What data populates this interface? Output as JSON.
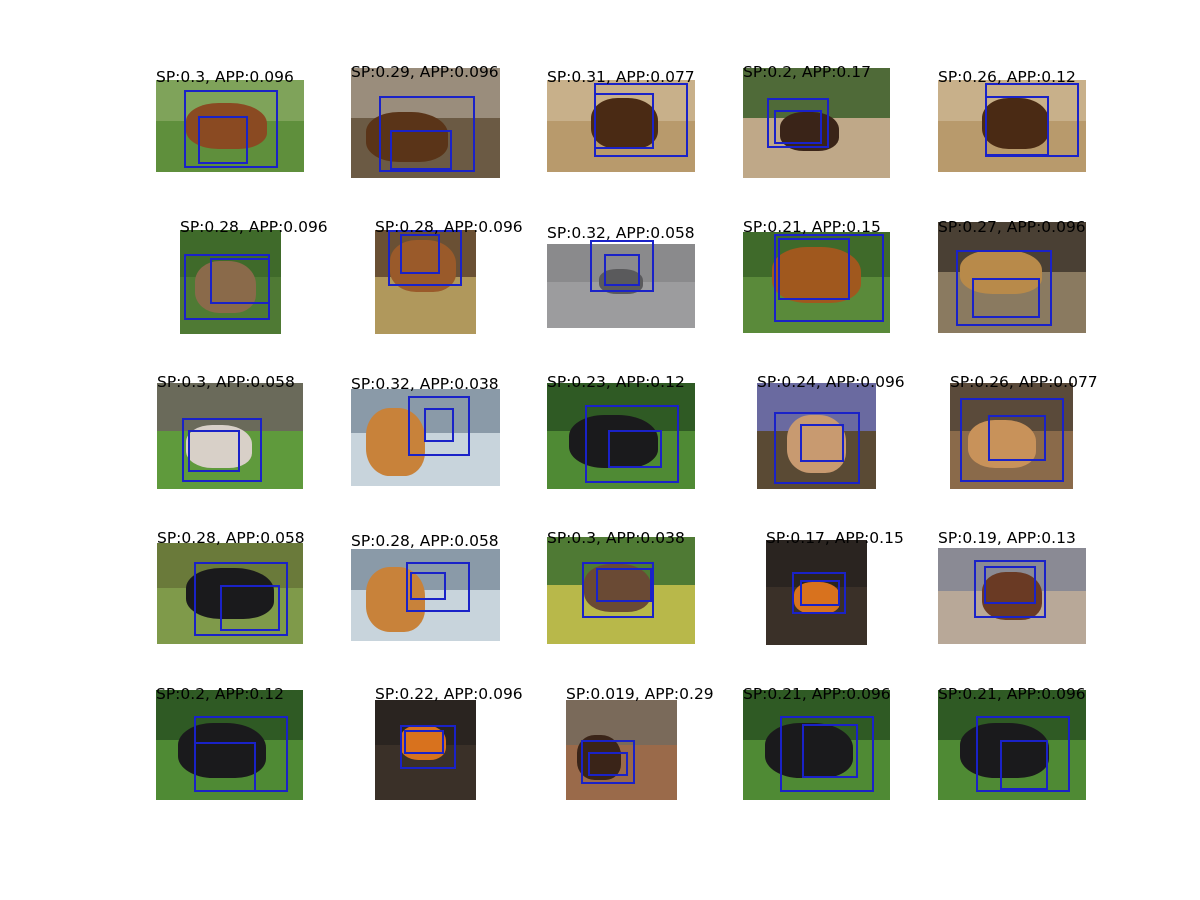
{
  "figure": {
    "panels": [
      {
        "caption": "SP:0.3,  APP:0.096",
        "colors": [
          "#7fa35a",
          "#5f8f3c"
        ],
        "horse": "#8a4a22"
      },
      {
        "caption": "SP:0.29,  APP:0.096",
        "colors": [
          "#9a8d7c",
          "#6b5a44"
        ],
        "horse": "#5a3418"
      },
      {
        "caption": "SP:0.31,  APP:0.077",
        "colors": [
          "#c8b08a",
          "#b89a6c"
        ],
        "horse": "#4a2a14"
      },
      {
        "caption": "SP:0.2,  APP:0.17",
        "colors": [
          "#4f6a38",
          "#bfa888"
        ],
        "horse": "#3a2418"
      },
      {
        "caption": "SP:0.26,  APP:0.12",
        "colors": [
          "#c8b08a",
          "#b89a6c"
        ],
        "horse": "#4a2a14"
      },
      {
        "caption": "SP:0.28,  APP:0.096",
        "colors": [
          "#3f6a2a",
          "#4f7a34"
        ],
        "horse": "#8a6a4a"
      },
      {
        "caption": "SP:0.28,  APP:0.096",
        "colors": [
          "#6a5034",
          "#b0985c"
        ],
        "horse": "#9a5a2a"
      },
      {
        "caption": "SP:0.32,  APP:0.058",
        "colors": [
          "#8a8a8c",
          "#9c9c9e"
        ],
        "horse": "#5a5a5c"
      },
      {
        "caption": "SP:0.21,  APP:0.15",
        "colors": [
          "#3f6a2a",
          "#5a8a3a"
        ],
        "horse": "#a0581e"
      },
      {
        "caption": "SP:0.27,  APP:0.096",
        "colors": [
          "#4a4034",
          "#8a7a60"
        ],
        "horse": "#b88a4a"
      },
      {
        "caption": "SP:0.3,  APP:0.058",
        "colors": [
          "#6a6a5a",
          "#5f9a3c"
        ],
        "horse": "#d8d0c8"
      },
      {
        "caption": "SP:0.32,  APP:0.038",
        "colors": [
          "#8a9aa8",
          "#c8d4dc"
        ],
        "horse": "#c8823a"
      },
      {
        "caption": "SP:0.23,  APP:0.12",
        "colors": [
          "#2f5a24",
          "#4f8a34"
        ],
        "horse": "#1a1a1c"
      },
      {
        "caption": "SP:0.24,  APP:0.096",
        "colors": [
          "#6a6aa0",
          "#5a4a34"
        ],
        "horse": "#c89a70"
      },
      {
        "caption": "SP:0.26,  APP:0.077",
        "colors": [
          "#5a4a3a",
          "#8a6a4a"
        ],
        "horse": "#c8925a"
      },
      {
        "caption": "SP:0.28,  APP:0.058",
        "colors": [
          "#6a7a3a",
          "#7f9a4a"
        ],
        "horse": "#1a1a1c"
      },
      {
        "caption": "SP:0.28,  APP:0.058",
        "colors": [
          "#8a9aa8",
          "#c8d4dc"
        ],
        "horse": "#c8823a"
      },
      {
        "caption": "SP:0.3,  APP:0.038",
        "colors": [
          "#4f7a34",
          "#b8b84a"
        ],
        "horse": "#6a4a34"
      },
      {
        "caption": "SP:0.17,  APP:0.15",
        "colors": [
          "#2a2420",
          "#3a3028"
        ],
        "horse": "#d8721e"
      },
      {
        "caption": "SP:0.19,  APP:0.13",
        "colors": [
          "#8a8a94",
          "#b8a898"
        ],
        "horse": "#6a3a24"
      },
      {
        "caption": "SP:0.2,  APP:0.12",
        "colors": [
          "#2f5a24",
          "#4f8a34"
        ],
        "horse": "#1a1a1c"
      },
      {
        "caption": "SP:0.22,  APP:0.096",
        "colors": [
          "#2a2420",
          "#3a3028"
        ],
        "horse": "#d8721e"
      },
      {
        "caption": "SP:0.019,  APP:0.29",
        "colors": [
          "#7a6a5a",
          "#9a6a4a"
        ],
        "horse": "#3a2418"
      },
      {
        "caption": "SP:0.21,  APP:0.096",
        "colors": [
          "#2f5a24",
          "#4f8a34"
        ],
        "horse": "#1a1a1c"
      },
      {
        "caption": "SP:0.21,  APP:0.096",
        "colors": [
          "#2f5a24",
          "#4f8a34"
        ],
        "horse": "#1a1a1c"
      }
    ]
  }
}
